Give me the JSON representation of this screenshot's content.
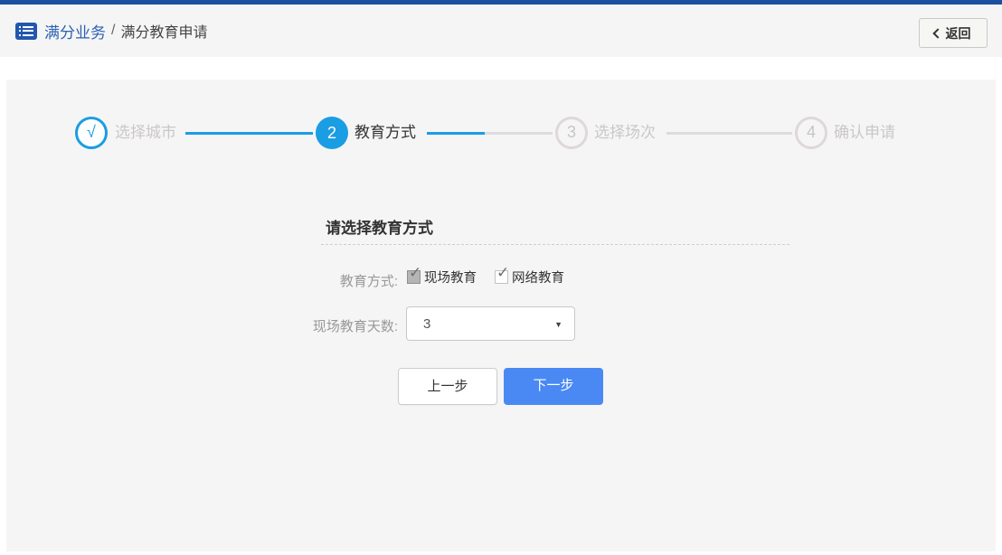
{
  "header": {
    "brand": "满分业务",
    "separator": "/",
    "page_title": "满分教育申请",
    "back_button": {
      "label": "返回"
    }
  },
  "icons": {
    "brand_icon": "menu-list",
    "back_icon": "chevron-left",
    "dropdown_arrow": "▼",
    "checkbox_check": "✓"
  },
  "stepper": {
    "steps": [
      {
        "number": "√",
        "label": "选择城市",
        "state": "done"
      },
      {
        "number": "2",
        "label": "教育方式",
        "state": "active"
      },
      {
        "number": "3",
        "label": "选择场次",
        "state": "pending"
      },
      {
        "number": "4",
        "label": "确认申请",
        "state": "pending"
      }
    ]
  },
  "form": {
    "title": "请选择教育方式",
    "education_row": {
      "label": "教育方式:",
      "options": [
        {
          "label": "现场教育",
          "checked": true,
          "disabled": true
        },
        {
          "label": "网络教育",
          "checked": true,
          "disabled": false
        }
      ]
    },
    "days_row": {
      "label": "现场教育天数:",
      "selected_value": "3"
    },
    "buttons": {
      "prev": "上一步",
      "next": "下一步"
    }
  },
  "colors": {
    "top_bar_navy": "#1c4fa0",
    "brand_blue": "#2b61b4",
    "stepper_blue": "#1b9de3",
    "primary_button_blue": "#4a89f3",
    "panel_gray": "#f5f5f5"
  }
}
